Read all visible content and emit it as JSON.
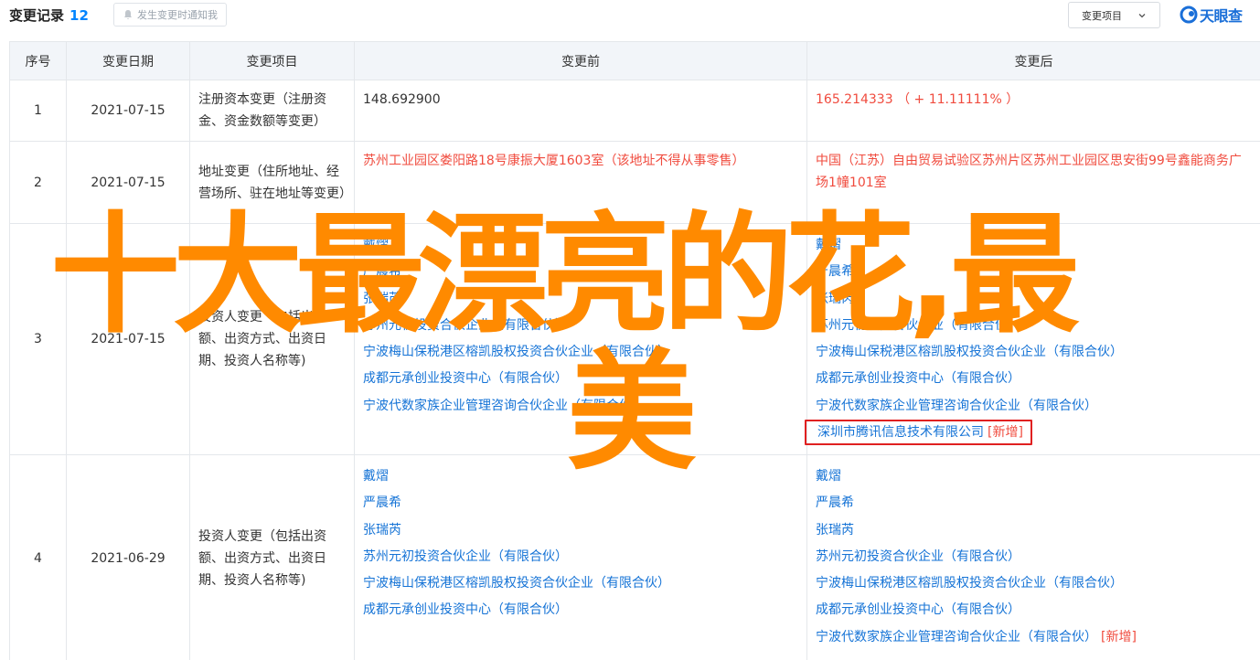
{
  "header": {
    "title": "变更记录",
    "count": "12",
    "notify_label": "发生变更时通知我",
    "select_label": "变更项目",
    "brand": "天眼查"
  },
  "table": {
    "columns": [
      "序号",
      "变更日期",
      "变更项目",
      "变更前",
      "变更后"
    ],
    "rows": [
      {
        "index": "1",
        "date": "2021-07-15",
        "item": "注册资本变更（注册资金、资金数额等变更）",
        "before": "148.692900",
        "after": "165.214333 （ + 11.11111% ）"
      },
      {
        "index": "2",
        "date": "2021-07-15",
        "item": "地址变更（住所地址、经营场所、驻在地址等变更）",
        "before": "苏州工业园区娄阳路18号康振大厦1603室（该地址不得从事零售）",
        "after": "中国（江苏）自由贸易试验区苏州片区苏州工业园区思安街99号鑫能商务广场1幢101室"
      },
      {
        "index": "3",
        "date": "2021-07-15",
        "item": "投资人变更（包括出资额、出资方式、出资日期、投资人名称等)",
        "before": [
          "戴熠",
          "严晨希",
          "张瑞芮",
          "苏州元初投资合伙企业（有限合伙）",
          "宁波梅山保税港区榕凯股权投资合伙企业（有限合伙）",
          "成都元承创业投资中心（有限合伙）",
          "宁波代数家族企业管理咨询合伙企业（有限合伙）"
        ],
        "after": [
          "戴熠",
          "严晨希",
          "张瑞芮",
          "苏州元初投资合伙企业（有限合伙）",
          "宁波梅山保税港区榕凯股权投资合伙企业（有限合伙）",
          "成都元承创业投资中心（有限合伙）",
          "宁波代数家族企业管理咨询合伙企业（有限合伙）"
        ],
        "after_new": "深圳市腾讯信息技术有限公司",
        "new_tag": "[新增]"
      },
      {
        "index": "4",
        "date": "2021-06-29",
        "item": "投资人变更（包括出资额、出资方式、出资日期、投资人名称等)",
        "before": [
          "戴熠",
          "严晨希",
          "张瑞芮",
          "苏州元初投资合伙企业（有限合伙）",
          "宁波梅山保税港区榕凯股权投资合伙企业（有限合伙）",
          "成都元承创业投资中心（有限合伙）"
        ],
        "after": [
          "戴熠",
          "严晨希",
          "张瑞芮",
          "苏州元初投资合伙企业（有限合伙）",
          "宁波梅山保税港区榕凯股权投资合伙企业（有限合伙）",
          "成都元承创业投资中心（有限合伙）"
        ],
        "after_last": "宁波代数家族企业管理咨询合伙企业（有限合伙）",
        "new_tag": "[新增]"
      }
    ]
  },
  "overlay": {
    "line1": "十大最漂亮的花,最",
    "line2": "美"
  },
  "colors": {
    "accent": "#0084ff",
    "link": "#1573d6",
    "change": "#f04b3e",
    "overlay_text": "#ff8a00",
    "highlight_box": "#e02020"
  },
  "icons": {
    "notify": "bell-icon",
    "select": "chevron-down-icon",
    "brand": "tianyancha-logo-icon"
  }
}
